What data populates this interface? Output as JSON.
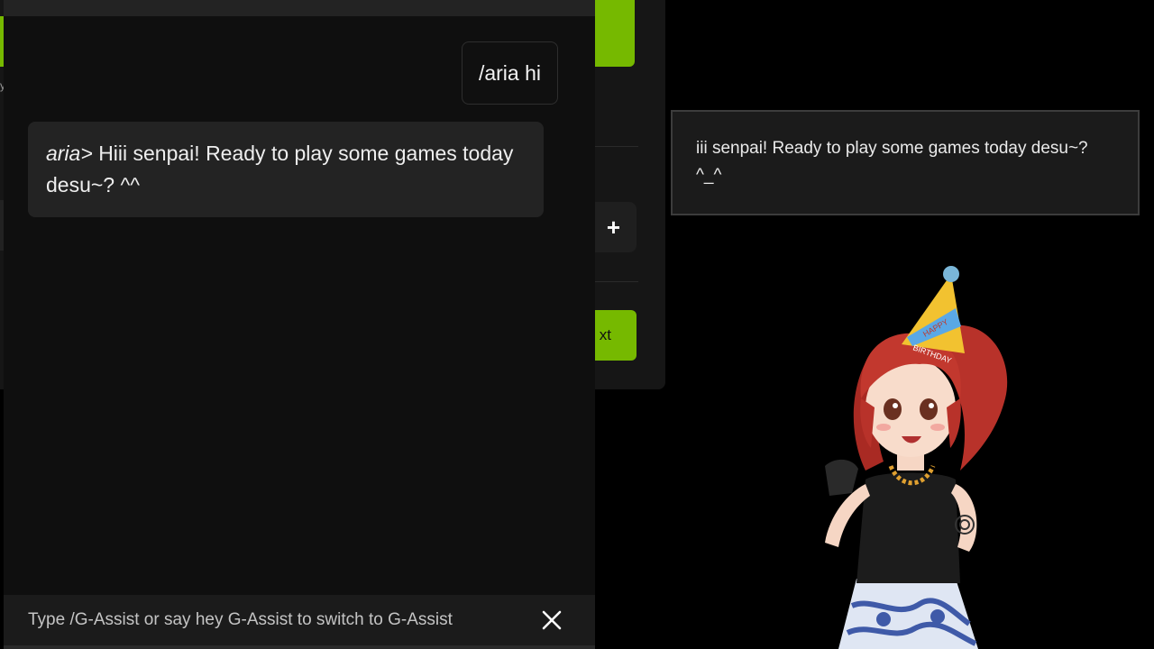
{
  "background_app": {
    "plus_label": "+",
    "next_label": "xt",
    "tiny_text": "y"
  },
  "chat": {
    "user_message": "/aria hi",
    "bot_speaker": "aria>",
    "bot_message": "Hiii senpai! Ready to play some games today desu~? ^^",
    "bottom_hint": "Type /G-Assist or say hey G-Assist to switch to G-Assist",
    "close_icon": "close-icon"
  },
  "overlay": {
    "subtitle_line1": "iii senpai! Ready to play some games today desu~?",
    "subtitle_line2": "^_^"
  },
  "character": {
    "hat_text_line1": "HAPPY",
    "hat_text_line2": "BIRTHDAY"
  },
  "colors": {
    "accent_green": "#76b900",
    "panel_bg": "#0f0f0f",
    "bubble_bg": "#232323"
  }
}
